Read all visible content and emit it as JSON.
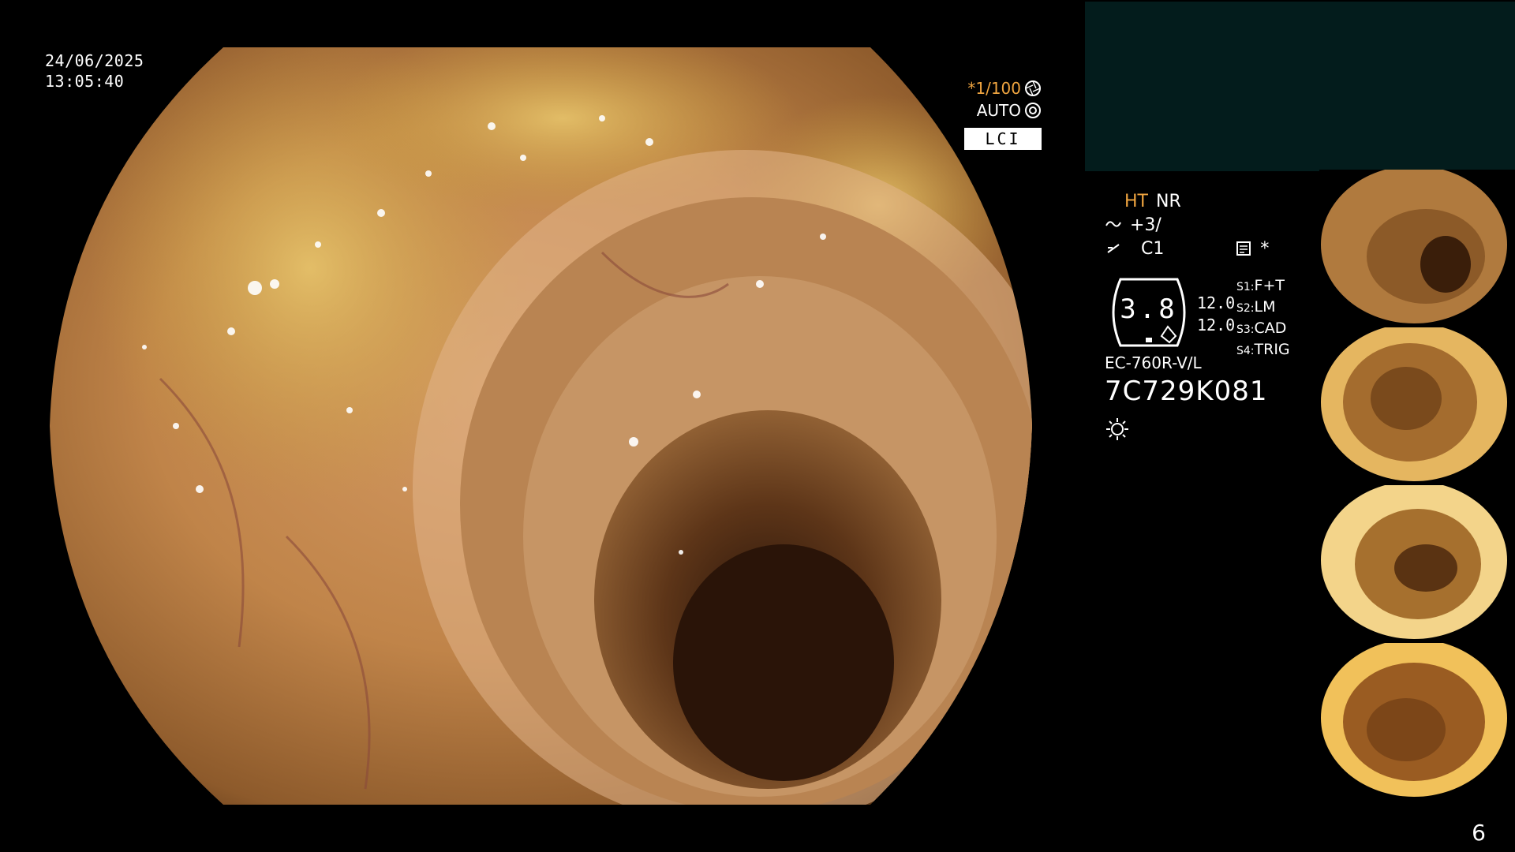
{
  "overlay": {
    "date": "24/06/2025",
    "time": "13:05:40",
    "shutter": "*1/100",
    "iris_mode": "AUTO",
    "light_mode": "LCI"
  },
  "processor": {
    "ht_label": "HT",
    "nr_label": "NR",
    "enhance_value": "+3/",
    "color_value": "C1",
    "ring_value": "3.8",
    "level_top": "12.0",
    "level_bottom": "12.0",
    "settings": [
      {
        "key": "S1:",
        "value": "F+T"
      },
      {
        "key": "S2:",
        "value": "LM"
      },
      {
        "key": "S3:",
        "value": "CAD"
      },
      {
        "key": "S4:",
        "value": "TRIG"
      }
    ],
    "asterisk": "*",
    "scope_model": "EC-760R-V/L",
    "scope_serial": "7C729K081"
  },
  "page_number": "6",
  "colors": {
    "accent_orange": "#f0a540",
    "panel_teal": "#031c1c",
    "background": "#000000"
  },
  "icons": [
    "shutter-icon",
    "iris-icon",
    "enhance-icon",
    "color-icon",
    "memo-icon",
    "light-icon"
  ],
  "thumbnails": 4
}
